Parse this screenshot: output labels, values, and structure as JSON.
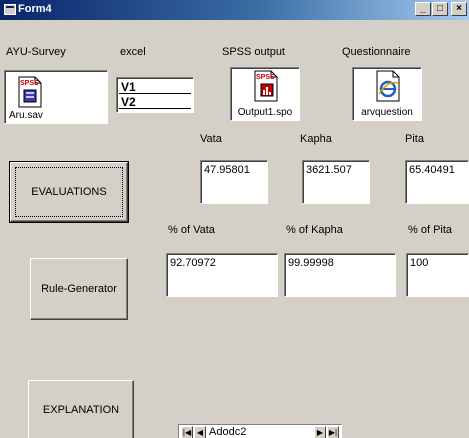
{
  "window": {
    "title": "Form4",
    "minimize": "_",
    "maximize": "□",
    "close": "×"
  },
  "labels": {
    "ayu_survey": "AYU-Survey",
    "excel": "excel",
    "spss_output": "SPSS output",
    "questionnaire": "Questionnaire",
    "vata": "Vata",
    "kapha": "Kapha",
    "pita": "Pita",
    "pct_vata": "% of Vata",
    "pct_kapha": "% of Kapha",
    "pct_pita": "% of Pita"
  },
  "files": {
    "aru_sav": "Aru.sav",
    "output_spo": "Output1.spo",
    "arvquestion": "arvquestion"
  },
  "excel_list": [
    "V1",
    "V2"
  ],
  "values": {
    "vata": "47.95801",
    "kapha": "3621.507",
    "pita": "65.40491",
    "pct_vata": "92.70972",
    "pct_kapha": "99.99998",
    "pct_pita": "100"
  },
  "buttons": {
    "evaluations": "EVALUATIONS",
    "rule_generator": "Rule-Generator",
    "explanation": "EXPLANATION"
  },
  "adodc": {
    "caption": "Adodc2",
    "first": "|◀",
    "prev": "◀",
    "next": "▶",
    "last": "▶|"
  },
  "colors": {
    "face": "#d4d0c8",
    "title_start": "#0a246a",
    "title_end": "#a6caf0",
    "spss_red": "#c00000",
    "ie_blue": "#1e5fbf"
  }
}
